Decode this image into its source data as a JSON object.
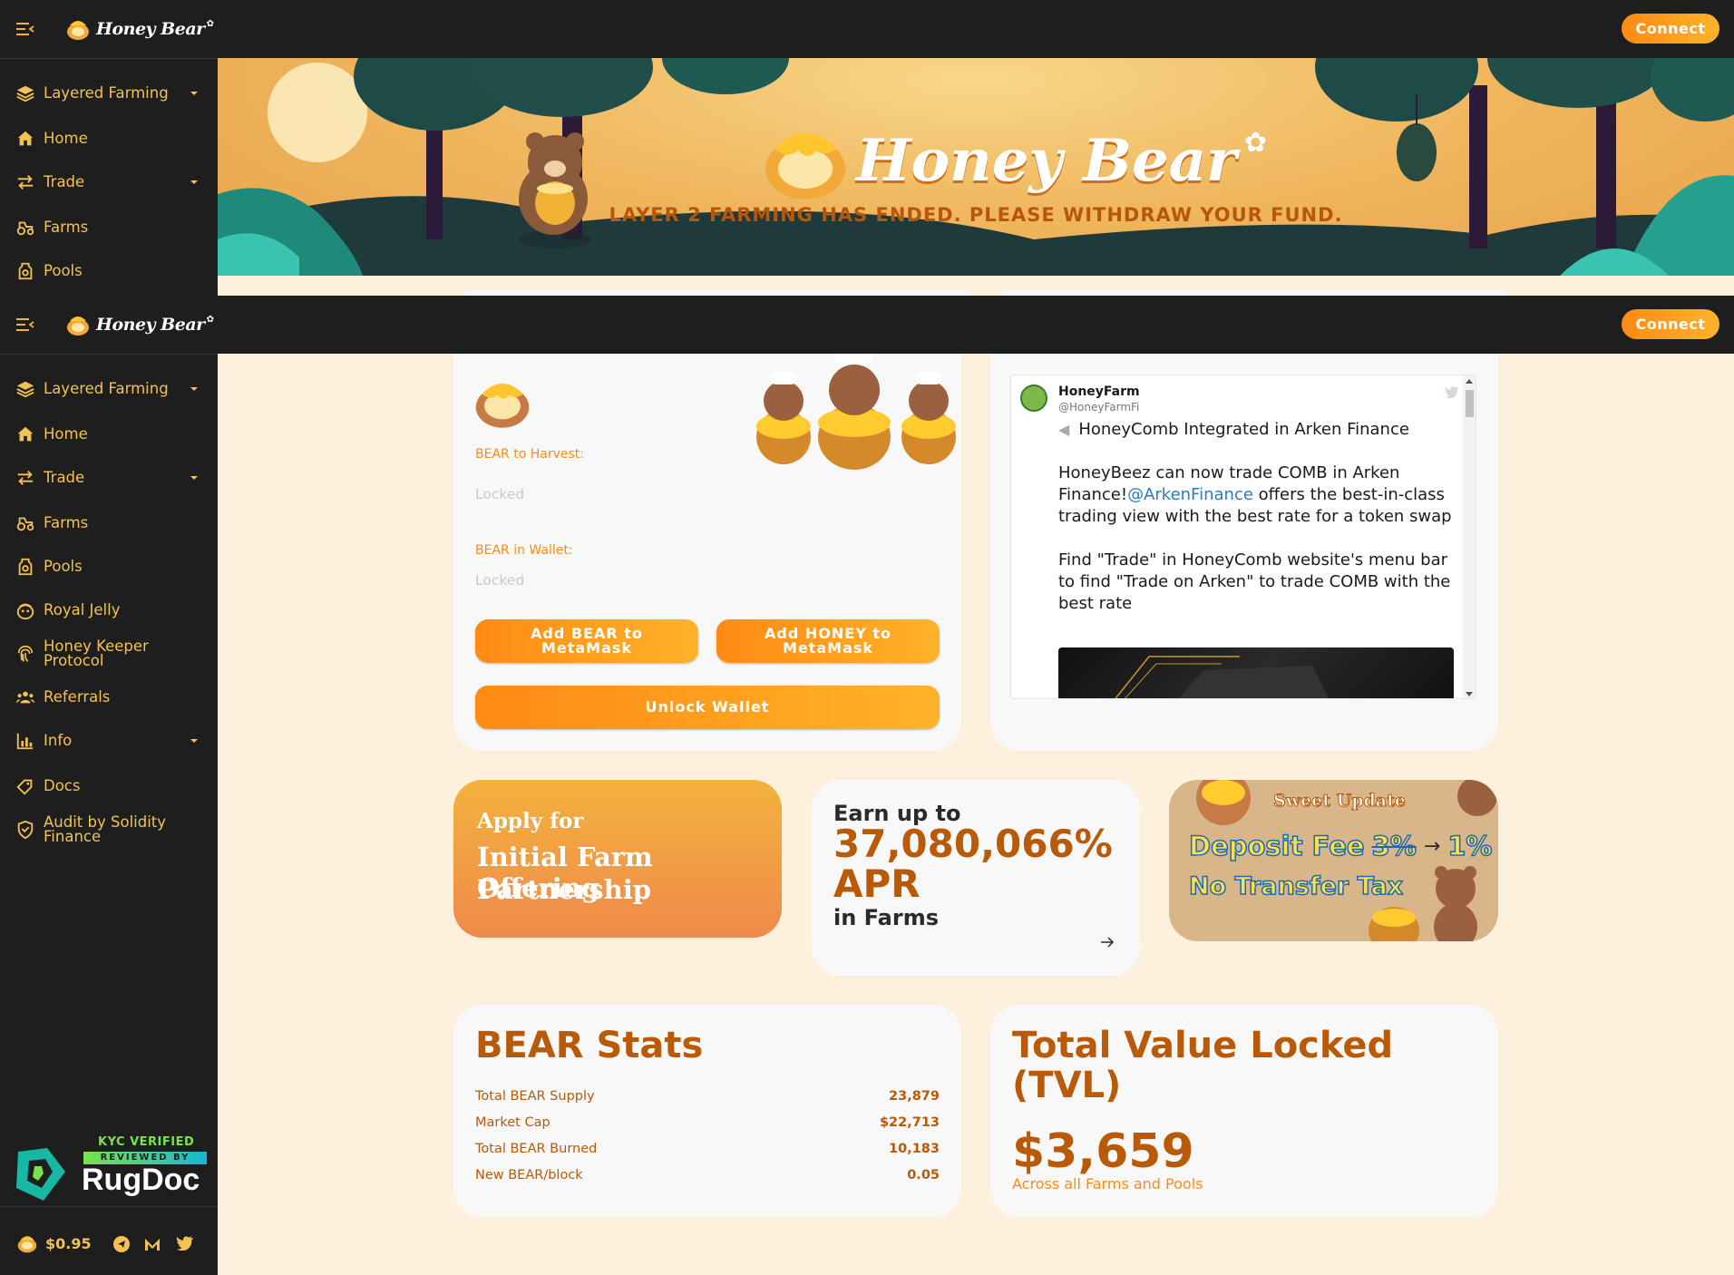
{
  "app": {
    "logo_text": "Honey Bear",
    "connect_label": "Connect"
  },
  "banner": {
    "logo_text": "Honey Bear",
    "message": "LAYER 2 FARMING HAS ENDED. PLEASE WITHDRAW YOUR FUND."
  },
  "sidebar_top": {
    "items": [
      {
        "label": "Layered Farming",
        "icon": "layers-icon",
        "dropdown": true
      },
      {
        "label": "Home",
        "icon": "home-icon",
        "dropdown": false
      },
      {
        "label": "Trade",
        "icon": "trade-icon",
        "dropdown": true
      },
      {
        "label": "Farms",
        "icon": "tractor-icon",
        "dropdown": false
      },
      {
        "label": "Pools",
        "icon": "pools-icon",
        "dropdown": false
      }
    ]
  },
  "sidebar": {
    "items": [
      {
        "label": "Layered Farming",
        "icon": "layers-icon",
        "dropdown": true
      },
      {
        "label": "Home",
        "icon": "home-icon",
        "dropdown": false
      },
      {
        "label": "Trade",
        "icon": "trade-icon",
        "dropdown": true
      },
      {
        "label": "Farms",
        "icon": "tractor-icon",
        "dropdown": false
      },
      {
        "label": "Pools",
        "icon": "pools-icon",
        "dropdown": false
      },
      {
        "label": "Royal Jelly",
        "icon": "royal-jelly-icon",
        "dropdown": false
      },
      {
        "label": "Honey Keeper Protocol",
        "icon": "fingerprint-icon",
        "dropdown": false
      },
      {
        "label": "Referrals",
        "icon": "referrals-icon",
        "dropdown": false
      },
      {
        "label": "Info",
        "icon": "chart-icon",
        "dropdown": true
      },
      {
        "label": "Docs",
        "icon": "docs-icon",
        "dropdown": false
      },
      {
        "label": "Audit by Solidity Finance",
        "icon": "shield-icon",
        "dropdown": false
      }
    ],
    "rugdoc": {
      "kyc": "KYC VERIFIED",
      "reviewed": "REVIEWED BY",
      "brand": "RugDoc"
    },
    "price": "$0.95"
  },
  "farms_card": {
    "harvest_label": "BEAR to Harvest:",
    "harvest_value": "Locked",
    "wallet_label": "BEAR in Wallet:",
    "wallet_value": "Locked",
    "add_bear_label": "Add BEAR to MetaMask",
    "add_honey_label": "Add HONEY to MetaMask",
    "unlock_label": "Unlock Wallet"
  },
  "tweet": {
    "name": "HoneyFarm",
    "handle": "@HoneyFarmFi",
    "headline": "HoneyComb Integrated in Arken Finance",
    "p1_a": "HoneyBeez can now trade COMB in Arken Finance!",
    "p1_link": "@ArkenFinance",
    "p1_b": " offers the best-in-class trading view with the best rate for a token swap",
    "p2": "Find \"Trade\" in HoneyComb website's menu bar to find \"Trade on Arken\" to trade COMB with the best rate"
  },
  "ifo_card": {
    "line1": "Apply for",
    "line2": "Initial Farm Offering",
    "line3": "Partnership"
  },
  "apr_card": {
    "pre": "Earn up to",
    "value": "37,080,066%",
    "apr": "APR",
    "post": "in Farms"
  },
  "update_card": {
    "title": "Sweet Update",
    "fee_label": "Deposit Fee",
    "fee_old": "3%",
    "fee_new": "1%",
    "tax": "No Transfer Tax"
  },
  "bear_stats": {
    "title": "BEAR Stats",
    "rows": [
      {
        "label": "Total BEAR Supply",
        "value": "23,879"
      },
      {
        "label": "Market Cap",
        "value": "$22,713"
      },
      {
        "label": "Total BEAR Burned",
        "value": "10,183"
      },
      {
        "label": "New BEAR/block",
        "value": "0.05"
      }
    ]
  },
  "tvl": {
    "title": "Total Value Locked (TVL)",
    "value": "$3,659",
    "sub": "Across all Farms and Pools"
  },
  "colors": {
    "accent": "#ff8a14",
    "sidebar": "#1e1e1e",
    "text_gold": "#f3c250",
    "stat_brown": "#b85a08",
    "page_bg": "#fdf0dc"
  }
}
